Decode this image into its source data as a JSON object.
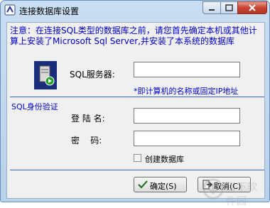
{
  "window": {
    "title": "连接数据库设置",
    "icons": {
      "app": "database-link-icon",
      "min": "minimize-icon",
      "max": "maximize-icon",
      "close": "close-icon"
    }
  },
  "notice": "注意：在连接SQL类型的数据库之前，请您首先确定本机或其他计算上安装了Microsoft Sql Server,并安装了本系统的数据库",
  "server": {
    "label": "SQL服务器:",
    "value": "",
    "hint": "*即计算机的名称或固定IP地址",
    "icon": "server-icon"
  },
  "auth": {
    "section_title": "SQL身份验证",
    "login_label": "登 陆 名:",
    "login_value": "",
    "password_label": "密    码:",
    "password_value": ""
  },
  "create_db": {
    "label": "创建数据库",
    "checked": false
  },
  "buttons": {
    "ok": "确定(S)",
    "cancel": "取消(C)",
    "ok_icon": "checkmark-icon",
    "cancel_icon": "exit-icon"
  },
  "watermark": {
    "text": "当下软件园",
    "logo": "watermark-logo-icon"
  },
  "colors": {
    "accent": "#0000c8",
    "close": "#c7432f"
  }
}
